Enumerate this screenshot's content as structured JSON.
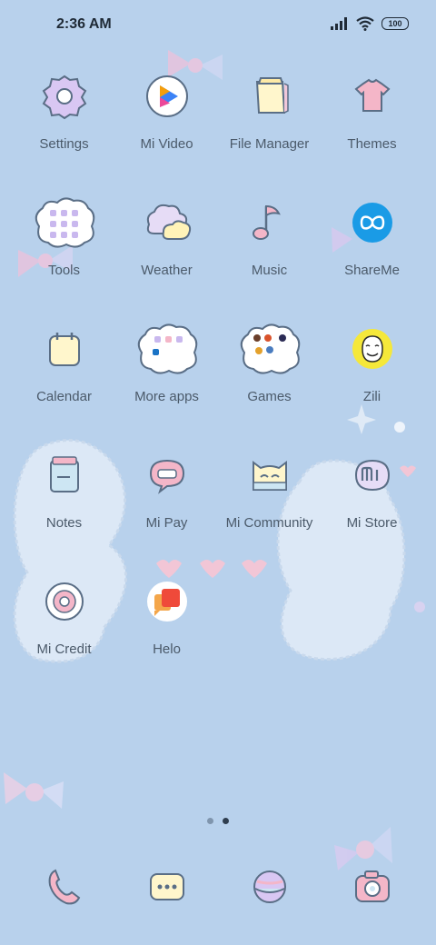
{
  "status": {
    "time": "2:36 AM",
    "battery": "100",
    "icons": [
      "signal-icon",
      "wifi-icon",
      "battery-icon"
    ]
  },
  "apps": [
    {
      "label": "Settings",
      "icon": "gear-icon"
    },
    {
      "label": "Mi Video",
      "icon": "play-icon"
    },
    {
      "label": "File Manager",
      "icon": "folder-icon"
    },
    {
      "label": "Themes",
      "icon": "shirt-icon"
    },
    {
      "label": "Tools",
      "icon": "folder-cloud-icon"
    },
    {
      "label": "Weather",
      "icon": "cloud-icon"
    },
    {
      "label": "Music",
      "icon": "music-note-icon"
    },
    {
      "label": "ShareMe",
      "icon": "infinity-icon"
    },
    {
      "label": "Calendar",
      "icon": "calendar-icon"
    },
    {
      "label": "More apps",
      "icon": "folder-cloud-icon"
    },
    {
      "label": "Games",
      "icon": "folder-cloud-icon"
    },
    {
      "label": "Zili",
      "icon": "smiley-face-icon"
    },
    {
      "label": "Notes",
      "icon": "notes-icon"
    },
    {
      "label": "Mi Pay",
      "icon": "card-icon"
    },
    {
      "label": "Mi Community",
      "icon": "cat-face-icon"
    },
    {
      "label": "Mi Store",
      "icon": "mi-logo-icon"
    },
    {
      "label": "Mi Credit",
      "icon": "donut-icon"
    },
    {
      "label": "Helo",
      "icon": "chat-bubbles-icon"
    }
  ],
  "dock": [
    {
      "icon": "phone-icon"
    },
    {
      "icon": "message-icon"
    },
    {
      "icon": "browser-planet-icon"
    },
    {
      "icon": "camera-icon"
    }
  ],
  "pages": {
    "count": 2,
    "current": 2
  },
  "colors": {
    "background": "#b8d1ec",
    "label": "#4b5a6a",
    "outline": "#5a6e86"
  }
}
